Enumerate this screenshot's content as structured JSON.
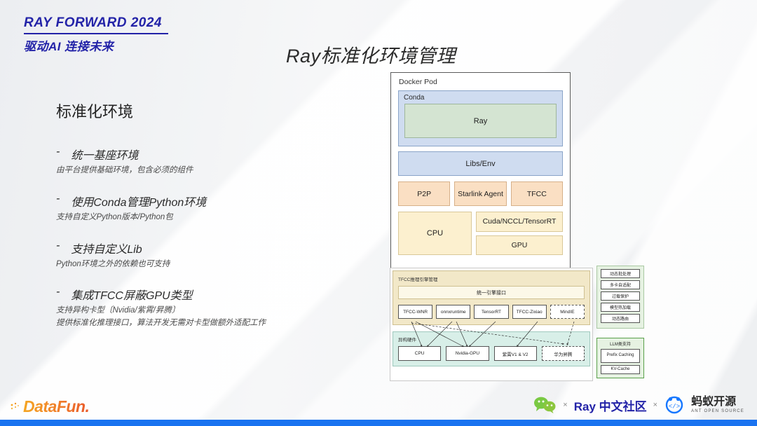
{
  "header": {
    "brand_title": "RAY FORWARD 2024",
    "brand_sub": "驱动AI 连接未来",
    "brand_color": "#2323a8"
  },
  "slide": {
    "title": "Ray标准化环境管理"
  },
  "left": {
    "section_head": "标准化环境",
    "bullets": [
      {
        "dash": "-",
        "main": "统一基座环境",
        "sub": "由平台提供基础环境，包含必须的组件"
      },
      {
        "dash": "-",
        "main": "使用Conda管理Python环境",
        "sub": "支持自定义Python版本/Python包"
      },
      {
        "dash": "-",
        "main": "支持自定义Lib",
        "sub": "Python环境之外的依赖也可支持"
      },
      {
        "dash": "-",
        "main": "集成TFCC屏蔽GPU类型",
        "sub": "支持异构卡型〔Nvidia/紫霄/昇腾〕\n提供标准化推理接口，算法开发无需对卡型做额外适配工作"
      }
    ]
  },
  "docker_pod": {
    "label": "Docker Pod",
    "conda_label": "Conda",
    "ray_label": "Ray",
    "libs_env_label": "Libs/Env",
    "middle_row": [
      "P2P",
      "Starlink Agent",
      "TFCC"
    ],
    "cpu_label": "CPU",
    "cuda_label": "Cuda/NCCL/TensorRT",
    "gpu_label": "GPU",
    "colors": {
      "conda": "#cfdcf0",
      "ray": "#d4e4d2",
      "middle": "#fadfc3",
      "bottom": "#fcf0cf"
    }
  },
  "tfcc_diagram": {
    "engine_section_title": "TFCC推理引擎管理",
    "unified_interface": "统一引擎接口",
    "engines": [
      {
        "label": "TFCC-WNR",
        "dashed": false
      },
      {
        "label": "onnxruntime",
        "dashed": false
      },
      {
        "label": "TensorRT",
        "dashed": false
      },
      {
        "label": "TFCC-Zixiao",
        "dashed": false
      },
      {
        "label": "MindIE",
        "dashed": true
      }
    ],
    "hardware_section_title": "异构硬件",
    "hardware": [
      {
        "label": "CPU",
        "dashed": false
      },
      {
        "label": "Nvidia-GPU",
        "dashed": false
      },
      {
        "label": "紫霄V1 & V2",
        "dashed": false
      },
      {
        "label": "华为昇腾",
        "dashed": true
      }
    ],
    "colors": {
      "engine_bg": "#f2e8c8",
      "hardware_bg": "#d8efe8"
    }
  },
  "feature_column": {
    "items": [
      "动态批处理",
      "多卡自适配",
      "过载保护",
      "模型热加载",
      "动态路由"
    ]
  },
  "llm_column": {
    "title": "LLM类支持",
    "items": [
      "Prefix Caching",
      "KV-Cache"
    ]
  },
  "footer": {
    "datafun_label": "DataFun.",
    "separator": "×",
    "ray_community": "Ray 中文社区",
    "ant_main": "蚂蚁开源",
    "ant_sub": "ANT OPEN SOURCE",
    "bar_color": "#1a73f0"
  }
}
